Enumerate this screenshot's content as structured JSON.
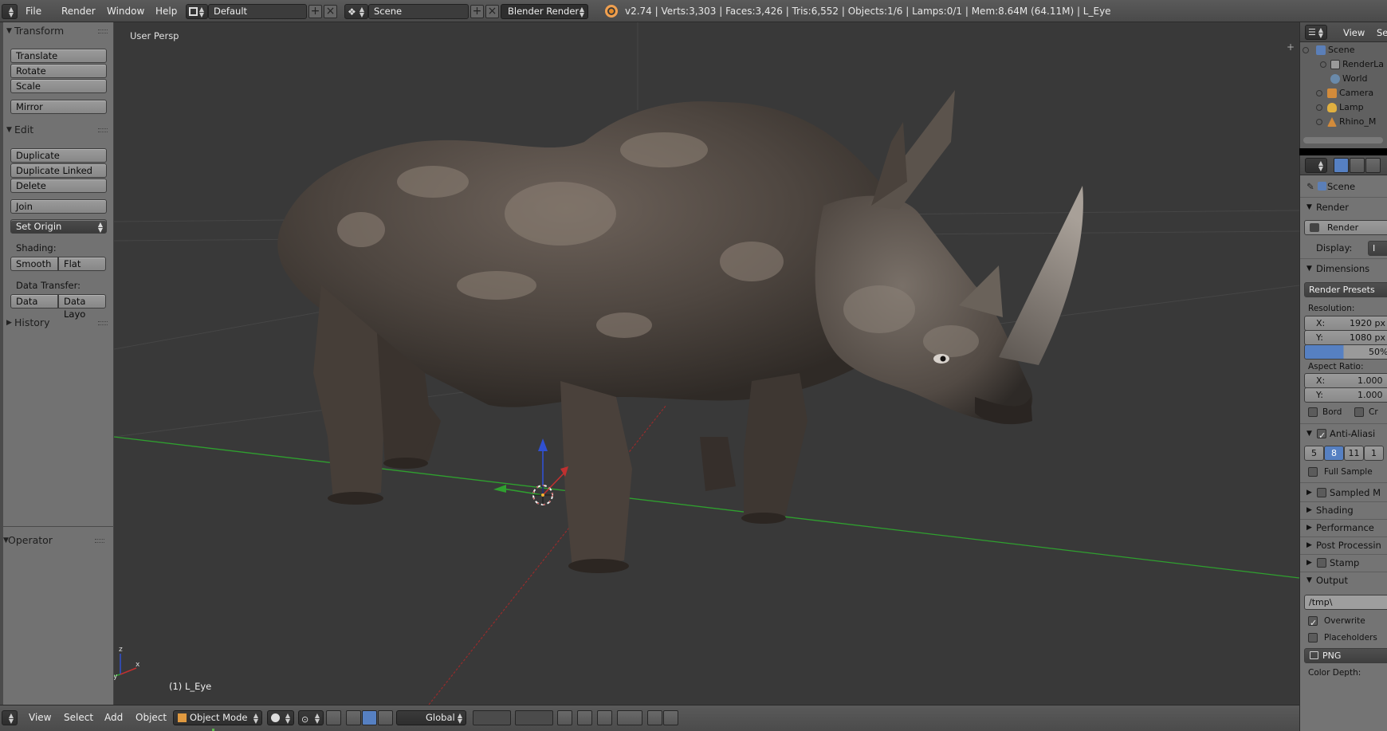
{
  "top_header": {
    "menus": [
      "File",
      "Render",
      "Window",
      "Help"
    ],
    "layout": "Default",
    "scene": "Scene",
    "engine": "Blender Render",
    "stats": "v2.74 | Verts:3,303 | Faces:3,426 | Tris:6,552 | Objects:1/6 | Lamps:0/1 | Mem:8.64M (64.11M) | L_Eye"
  },
  "tool_shelf": {
    "transform": {
      "title": "Transform",
      "buttons": [
        "Translate",
        "Rotate",
        "Scale",
        "Mirror"
      ]
    },
    "edit": {
      "title": "Edit",
      "buttons": [
        "Duplicate",
        "Duplicate Linked",
        "Delete",
        "Join"
      ],
      "set_origin": "Set Origin",
      "shading_label": "Shading:",
      "shading_buttons": [
        "Smooth",
        "Flat"
      ],
      "data_transfer_label": "Data Transfer:",
      "data_buttons": [
        "Data",
        "Data Layo"
      ]
    },
    "history": {
      "title": "History"
    },
    "operator": {
      "title": "Operator"
    }
  },
  "viewport": {
    "view_name": "User Persp",
    "active_object": "(1) L_Eye"
  },
  "outliner": {
    "header": {
      "view": "View",
      "search": "Se"
    },
    "items": [
      "Scene",
      "RenderLa",
      "World",
      "Camera",
      "Lamp",
      "Rhino_M"
    ]
  },
  "properties": {
    "scene_label": "Scene",
    "render_section": "Render",
    "render_button": "Render",
    "display_label": "Display:",
    "display_value": "I",
    "dimensions_section": "Dimensions",
    "render_presets": "Render Presets",
    "resolution_label": "Resolution:",
    "res_x": {
      "axis": "X:",
      "value": "1920 px"
    },
    "res_y": {
      "axis": "Y:",
      "value": "1080 px"
    },
    "res_percent": "50%",
    "aspect_label": "Aspect Ratio:",
    "aspect_x": {
      "axis": "X:",
      "value": "1.000"
    },
    "aspect_y": {
      "axis": "Y:",
      "value": "1.000"
    },
    "border": "Bord",
    "crop": "Cr",
    "anti_aliasing": "Anti-Aliasi",
    "aa_samples": [
      "5",
      "8",
      "11",
      "1"
    ],
    "aa_selected": "8",
    "full_sample": "Full Sample",
    "sampled_motion": "Sampled M",
    "shading": "Shading",
    "performance": "Performance",
    "post_processing": "Post Processin",
    "stamp": "Stamp",
    "output": "Output",
    "output_path": "/tmp\\",
    "overwrite": "Overwrite",
    "placeholders": "Placeholders",
    "file_format": "PNG",
    "color_depth": "Color Depth:"
  },
  "bottom_header": {
    "menus": [
      "View",
      "Select",
      "Add",
      "Object"
    ],
    "mode": "Object Mode",
    "orientation": "Global"
  },
  "colors": {
    "viewport_bg": "#393939",
    "x_axis": "#c03030",
    "y_axis": "#2fa02f",
    "z_axis": "#3050d0",
    "rhino_body": "#4f4640",
    "selection_blue": "#5680c2"
  }
}
